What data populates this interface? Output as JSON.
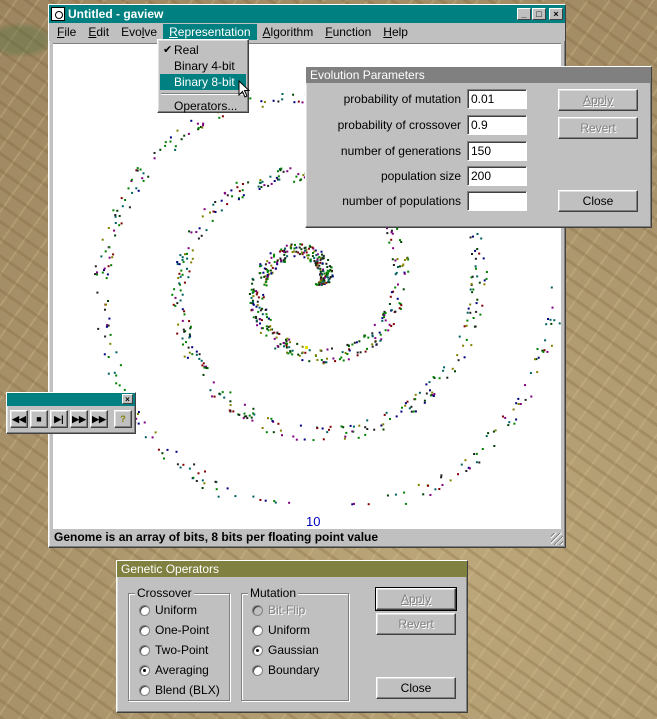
{
  "main_window": {
    "title": "Untitled - gaview",
    "controls": [
      "_",
      "□",
      "×"
    ],
    "menu": [
      {
        "label": "File",
        "key": "F",
        "rest": "ile"
      },
      {
        "label": "Edit",
        "key": "E",
        "rest": "dit"
      },
      {
        "label": "Evolve",
        "pre": "Evo",
        "key": "l",
        "rest": "ve"
      },
      {
        "label": "Representation",
        "key": "R",
        "rest": "epresentation"
      },
      {
        "label": "Algorithm",
        "key": "A",
        "rest": "lgorithm"
      },
      {
        "label": "Function",
        "key": "F",
        "rest": "unction"
      },
      {
        "label": "Help",
        "key": "H",
        "rest": "elp"
      }
    ],
    "generation": "10",
    "status": "Genome is an array of bits, 8 bits per floating point value"
  },
  "representation_menu": {
    "items": [
      {
        "label": "Real",
        "checked": true
      },
      {
        "label": "Binary 4-bit",
        "checked": false
      },
      {
        "label": "Binary 8-bit",
        "checked": false,
        "selected": true
      }
    ],
    "operators_label": "Operators..."
  },
  "evolution_parameters": {
    "title": "Evolution Parameters",
    "fields": [
      {
        "label": "probability of mutation",
        "value": "0.01"
      },
      {
        "label": "probability of crossover",
        "value": "0.9"
      },
      {
        "label": "number of generations",
        "value": "150"
      },
      {
        "label": "population size",
        "value": "200"
      },
      {
        "label": "number of populations",
        "value": ""
      }
    ],
    "apply_label": "Apply",
    "revert_label": "Revert",
    "close_label": "Close"
  },
  "playback_toolbar": {
    "buttons": [
      "rewind",
      "stop",
      "step",
      "fast-forward",
      "play",
      "help"
    ]
  },
  "genetic_operators": {
    "title": "Genetic Operators",
    "crossover_title": "Crossover",
    "crossover_options": [
      {
        "label": "Uniform",
        "selected": false
      },
      {
        "label": "One-Point",
        "selected": false
      },
      {
        "label": "Two-Point",
        "selected": false
      },
      {
        "label": "Averaging",
        "selected": true
      },
      {
        "label": "Blend (BLX)",
        "selected": false
      }
    ],
    "mutation_title": "Mutation",
    "mutation_options": [
      {
        "label": "Bit-Flip",
        "selected": false,
        "disabled": true
      },
      {
        "label": "Uniform",
        "selected": false,
        "disabled": false
      },
      {
        "label": "Gaussian",
        "selected": true,
        "disabled": false
      },
      {
        "label": "Boundary",
        "selected": false,
        "disabled": false
      }
    ],
    "apply_label": "Apply",
    "revert_label": "Revert",
    "close_label": "Close"
  },
  "colors": {
    "title_active": "#008080",
    "title_inactive": "#808080",
    "face": "#c0c0c0",
    "generation_text": "#0000c0"
  }
}
